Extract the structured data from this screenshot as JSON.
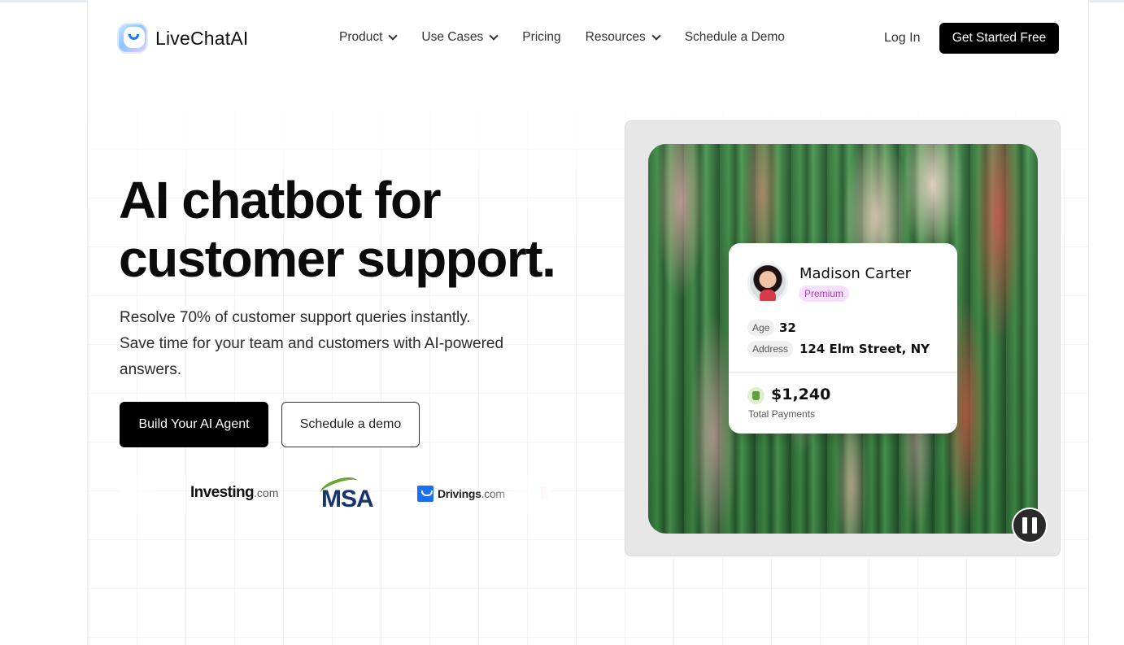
{
  "nav": {
    "brand": "LiveChatAI",
    "menu": [
      {
        "label": "Product",
        "has_dropdown": true
      },
      {
        "label": "Use Cases",
        "has_dropdown": true
      },
      {
        "label": "Pricing",
        "has_dropdown": false
      },
      {
        "label": "Resources",
        "has_dropdown": true
      },
      {
        "label": "Schedule a Demo",
        "has_dropdown": false
      }
    ],
    "login": "Log In",
    "cta": "Get Started Free"
  },
  "hero": {
    "title_line1": "AI chatbot for",
    "title_line2": "customer support.",
    "subtitle_line1": "Resolve 70% of customer support queries instantly.",
    "subtitle_line2": "Save time for your team and customers with AI-powered answers.",
    "primary_button": "Build Your AI Agent",
    "secondary_button": "Schedule a demo"
  },
  "logos": {
    "investing_name": "Investing",
    "investing_domain": ".com",
    "msa": "MSA",
    "drivings_name": "Drivings",
    "drivings_domain": ".com"
  },
  "profile_card": {
    "name": "Madison Carter",
    "tier": "Premium",
    "age_label": "Age",
    "age_value": "32",
    "address_label": "Address",
    "address_value": "124 Elm Street, NY",
    "total": "$1,240",
    "total_label": "Total Payments"
  },
  "media": {
    "control_icon": "pause-icon"
  },
  "colors": {
    "primary": "#000000",
    "brand_blue": "#1a73ff",
    "badge_bg": "#f6e0fb",
    "badge_text": "#a13fb8"
  }
}
